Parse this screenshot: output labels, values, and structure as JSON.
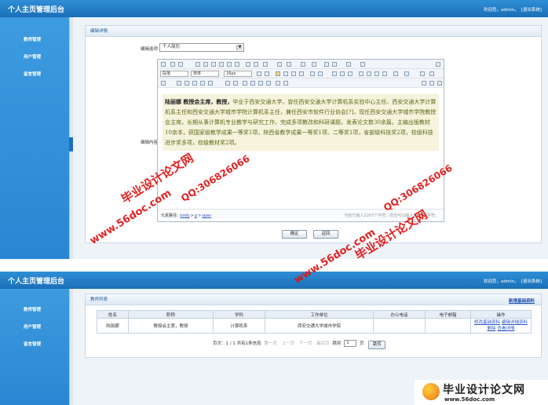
{
  "app_title": "个人主页管理后台",
  "header_user": {
    "welcome": "欢迎您，admin，",
    "logout": "[退出系统]"
  },
  "sidebar": {
    "items": [
      {
        "label": "教师管理"
      },
      {
        "label": "用户管理"
      },
      {
        "label": "留言管理"
      }
    ]
  },
  "edit_panel": {
    "title": "编辑详情",
    "option_label": "编辑选项",
    "option_value": "个人简历",
    "content_label": "编辑内容",
    "toolbar": {
      "format": "段落",
      "font": "宋体",
      "size": "16px"
    },
    "content_name": "陆丽娜  教授会主席，教授，",
    "content_text": "毕业于西安交通大学，曾任西安交通大学计算机系实验中心主任、西安交通大学计算机系主任和西安交通大学城市学院计算机系主任，兼任西安市软件行业协会[?]，现任西安交通大学城市学院教授会主席，长期从事计算机专业教学与研究工作，完成多项教改和科研课题，发表论文数30余篇，主编出版教材10余本，获国家级教学成果一等奖1项，陕西省教学成果一等奖1项、二等奖1项，省部级科技奖2项，校级科技进步奖多项，校级教材奖2项。",
    "status_path_label": "元素路径:",
    "status_path": [
      "body",
      "p",
      "span"
    ],
    "status_count": "当前已输入2207个字符，您还可以输入7793个字符。",
    "confirm": "确定",
    "back": "返回"
  },
  "list_panel": {
    "title": "教师列表",
    "add_link": "新增基础资料",
    "columns": [
      "姓名",
      "职称",
      "学科",
      "工作单位",
      "办公电话",
      "电子邮箱",
      "操作"
    ],
    "rows": [
      {
        "name": "陆丽娜",
        "title": "教授会主席，教授",
        "subject": "计算机系",
        "unit": "西安交通大学城市学院",
        "phone": "",
        "email": "",
        "actions": [
          "修改基础资料",
          "编辑详细资料",
          "删除",
          "查看详情"
        ]
      }
    ],
    "pager": {
      "info": "页次：1 / 1 共有1条信息",
      "first": "第一页",
      "prev": "上一页",
      "next": "下一页",
      "last": "最后页",
      "goto": "跳到",
      "page_value": "1",
      "page_unit": "页",
      "go": "跳转"
    }
  },
  "watermarks": {
    "site": "毕业设计论文网",
    "url": "www.56doc.com",
    "qq": "QQ:306826066",
    "logo_big": "毕业设计论文网",
    "logo_small": "www.56doc.com"
  }
}
